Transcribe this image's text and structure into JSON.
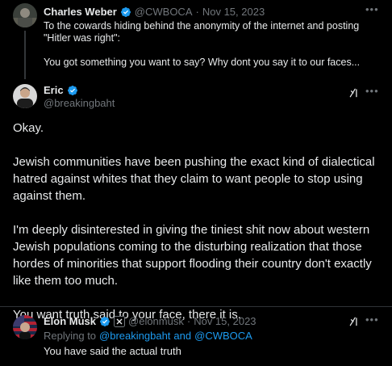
{
  "colors": {
    "background": "#000000",
    "text": "#e7e9ea",
    "muted": "#71767b",
    "link": "#1d9bf0",
    "verified": "#1d9bf0",
    "divider": "#2f3336"
  },
  "tweets": [
    {
      "display_name": "Charles Weber",
      "handle": "@CWBOCA",
      "separator": "·",
      "date": "Nov 15, 2023",
      "text": "To the cowards hiding behind the anonymity of the internet and posting \"Hitler was right\":\n\nYou got something you want to say? Why dont you say it to our faces...",
      "more_icon": "more-horizontal-icon"
    },
    {
      "display_name": "Eric",
      "handle": "@breakingbaht",
      "paragraphs": [
        "Okay.",
        "Jewish communities have been pushing the exact kind of dialectical hatred against whites that they claim to want people to stop using against them.",
        "I'm deeply disinterested in giving the tiniest shit now about western Jewish populations coming to the disturbing realization that those hordes of minorities that support flooding their country don't exactly like them too much.",
        "You want truth said to your face, there it is."
      ],
      "grok_icon": "grok-icon"
    },
    {
      "display_name": "Elon Musk",
      "handle": "@elonmusk",
      "separator": "·",
      "date": "Nov 15, 2023",
      "replying_prefix": "Replying to",
      "reply_to_1": "@breakingbaht",
      "reply_and": "and",
      "reply_to_2": "@CWBOCA",
      "text": "You have said the actual truth",
      "grok_icon": "grok-icon",
      "affiliate_badge_icon": "x-affiliate-badge-icon"
    }
  ]
}
